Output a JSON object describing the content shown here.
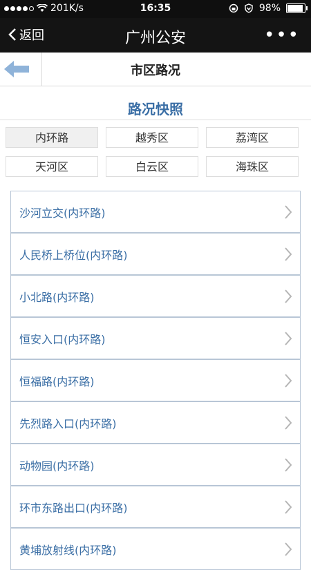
{
  "status_bar": {
    "carrier_speed": "201K/s",
    "time": "16:35",
    "battery": "98%"
  },
  "nav": {
    "back_label": "返回",
    "title": "广州公安",
    "more_label": "•••"
  },
  "page": {
    "title": "市区路况"
  },
  "section_title": "路况快照",
  "districts": [
    {
      "label": "内环路",
      "selected": true
    },
    {
      "label": "越秀区",
      "selected": false
    },
    {
      "label": "荔湾区",
      "selected": false
    },
    {
      "label": "天河区",
      "selected": false
    },
    {
      "label": "白云区",
      "selected": false
    },
    {
      "label": "海珠区",
      "selected": false
    }
  ],
  "roads": [
    "沙河立交(内环路)",
    "人民桥上桥位(内环路)",
    "小北路(内环路)",
    "恒安入口(内环路)",
    "恒福路(内环路)",
    "先烈路入口(内环路)",
    "动物园(内环路)",
    "环市东路出口(内环路)",
    "黄埔放射线(内环路)"
  ],
  "colors": {
    "accent": "#3a6ea5",
    "nav_bg": "#141414",
    "back_arrow": "#8fb3d9"
  }
}
